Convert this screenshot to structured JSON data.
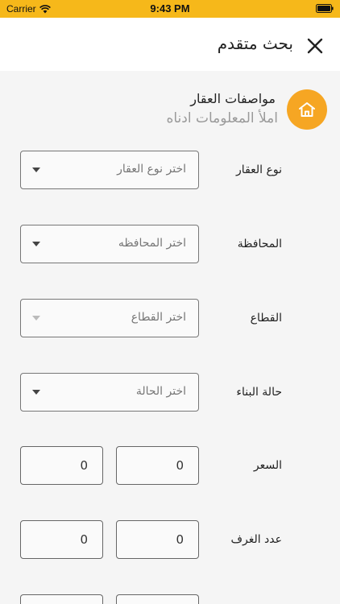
{
  "status_bar": {
    "carrier": "Carrier",
    "time": "9:43 PM"
  },
  "header": {
    "title": "بحث متقدم",
    "close_icon": "close-icon"
  },
  "section": {
    "title": "مواصفات العقار",
    "subtitle": "املأ المعلومات ادناه",
    "icon": "home-icon",
    "accent_color": "#f6a623"
  },
  "fields": {
    "property_type": {
      "label": "نوع العقار",
      "placeholder": "اختر نوع العقار"
    },
    "governorate": {
      "label": "المحافظة",
      "placeholder": "اختر المحافظه"
    },
    "sector": {
      "label": "القطاع",
      "placeholder": "اختر القطاع"
    },
    "building_status": {
      "label": "حالة البناء",
      "placeholder": "اختر الحالة"
    },
    "price": {
      "label": "السعر",
      "min": "0",
      "max": "0"
    },
    "rooms": {
      "label": "عدد الغرف",
      "min": "0",
      "max": "0"
    }
  },
  "colors": {
    "status_bar": "#f6b81a",
    "header_bg": "#ffffff",
    "page_bg": "#f5f5f5"
  }
}
